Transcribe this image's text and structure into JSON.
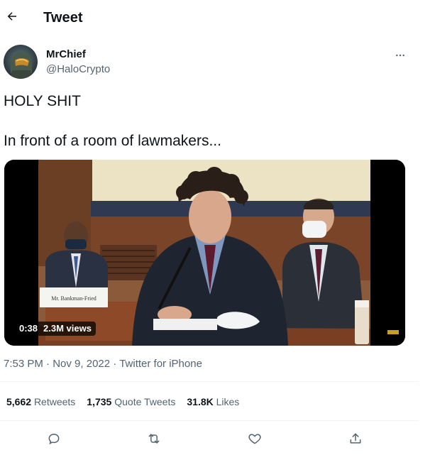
{
  "header": {
    "title": "Tweet",
    "back_icon": "arrow-left-icon"
  },
  "author": {
    "name": "MrChief",
    "handle": "@HaloCrypto",
    "avatar_icon": "halo-helmet-avatar",
    "more_icon": "more-horizontal-icon"
  },
  "tweet": {
    "line1": "HOLY SHIT",
    "line2": "In front of a room of lawmakers..."
  },
  "media": {
    "duration": "0:38",
    "views": "2.3M views",
    "nameplate": "Mr. Bankman-Fried"
  },
  "meta": {
    "time": "7:53 PM",
    "sep1": "·",
    "date": "Nov 9, 2022",
    "sep2": "·",
    "source": "Twitter for iPhone"
  },
  "stats": {
    "retweets_count": "5,662",
    "retweets_label": "Retweets",
    "quotes_count": "1,735",
    "quotes_label": "Quote Tweets",
    "likes_count": "31.8K",
    "likes_label": "Likes"
  },
  "actions": {
    "reply_icon": "reply-icon",
    "retweet_icon": "retweet-icon",
    "like_icon": "heart-icon",
    "share_icon": "share-icon"
  },
  "colors": {
    "text": "#0f1419",
    "secondary": "#536471",
    "divider": "#eff3f4"
  }
}
